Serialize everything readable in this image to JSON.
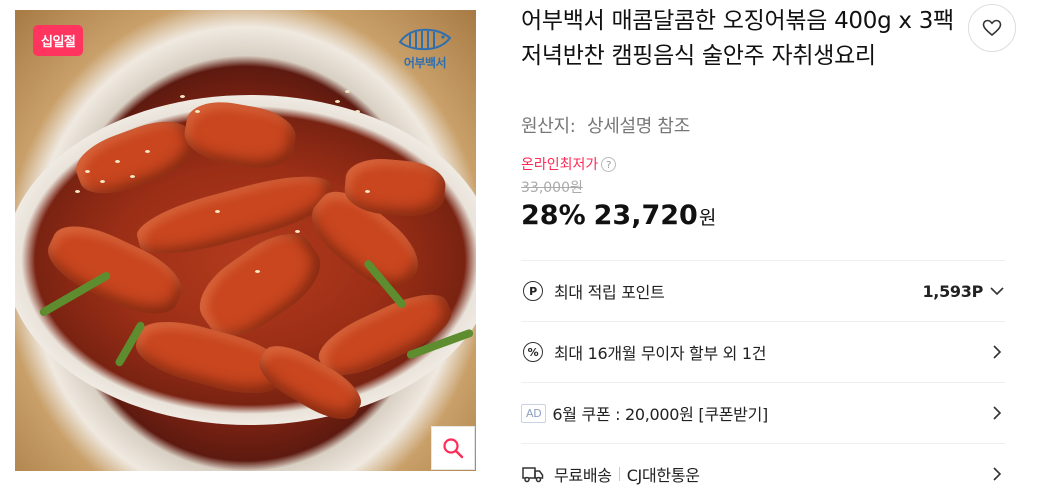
{
  "image": {
    "badge": "십일절",
    "brand_logo_text": "어부백서",
    "zoom_icon": "magnifier-icon"
  },
  "product": {
    "title": "어부백서 매콤달콤한 오징어볶음 400g x 3팩 저녁반찬 캠핑음식 술안주 자취생요리",
    "origin_label": "원산지:",
    "origin_value": "상세설명 참조"
  },
  "pricing": {
    "lowest_label": "온라인최저가",
    "help_icon": "question-icon",
    "original_price": "33,000원",
    "discount": "28%",
    "price": "23,720",
    "currency": "원",
    "accent_color": "#ff2a55"
  },
  "rows": {
    "points": {
      "icon": "P",
      "label": "최대 적립 포인트",
      "value": "1,593P"
    },
    "installment": {
      "icon": "%",
      "label": "최대 16개월 무이자 할부 외 1건"
    },
    "coupon": {
      "badge": "AD",
      "label": "6월 쿠폰 : 20,000원 [쿠폰받기]"
    },
    "shipping": {
      "label": "무료배송",
      "carrier": "CJ대한통운"
    }
  }
}
